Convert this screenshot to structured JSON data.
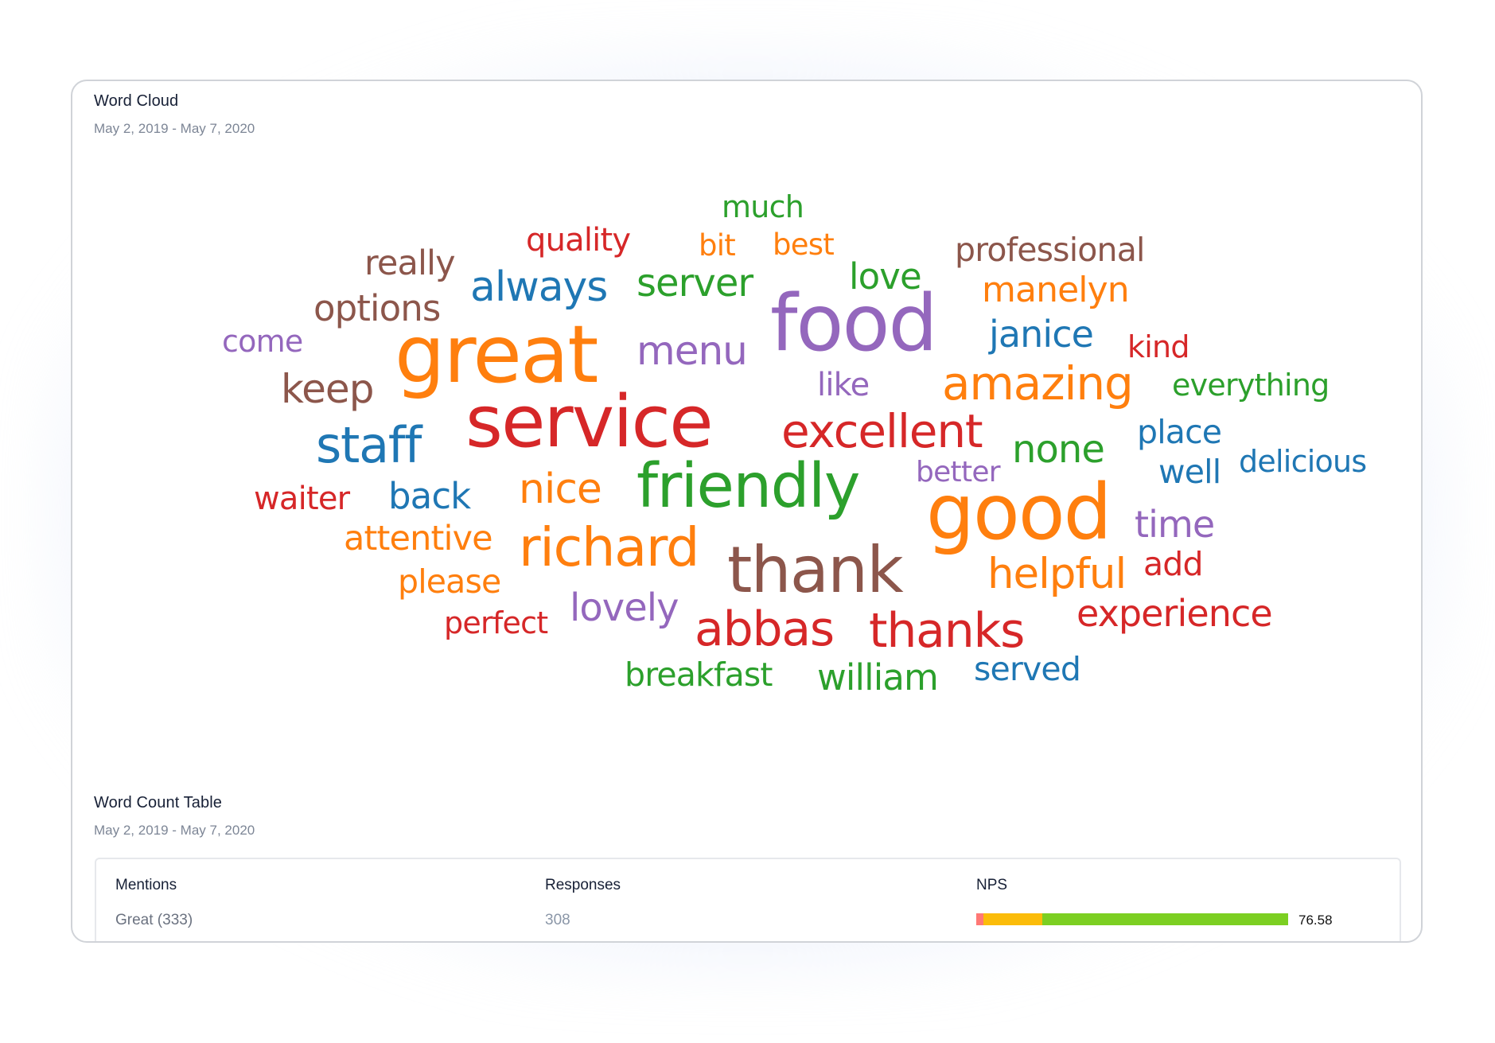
{
  "word_cloud": {
    "title": "Word Cloud",
    "date_range": "May 2, 2019 - May 7, 2020",
    "palette": {
      "blue": "#1f77b4",
      "orange": "#ff7f0e",
      "green": "#2ca02c",
      "red": "#d62728",
      "purple": "#9467bd",
      "brown": "#8c564b"
    },
    "words": [
      {
        "text": "much",
        "weight": 38,
        "color": "green"
      },
      {
        "text": "quality",
        "weight": 40,
        "color": "red"
      },
      {
        "text": "bit",
        "weight": 37,
        "color": "orange"
      },
      {
        "text": "best",
        "weight": 37,
        "color": "orange"
      },
      {
        "text": "really",
        "weight": 43,
        "color": "brown"
      },
      {
        "text": "professional",
        "weight": 41,
        "color": "brown"
      },
      {
        "text": "always",
        "weight": 52,
        "color": "blue"
      },
      {
        "text": "server",
        "weight": 48,
        "color": "green"
      },
      {
        "text": "love",
        "weight": 45,
        "color": "green"
      },
      {
        "text": "manelyn",
        "weight": 44,
        "color": "orange"
      },
      {
        "text": "options",
        "weight": 45,
        "color": "brown"
      },
      {
        "text": "food",
        "weight": 98,
        "color": "purple"
      },
      {
        "text": "janice",
        "weight": 46,
        "color": "blue"
      },
      {
        "text": "kind",
        "weight": 38,
        "color": "red"
      },
      {
        "text": "come",
        "weight": 38,
        "color": "purple"
      },
      {
        "text": "great",
        "weight": 100,
        "color": "orange"
      },
      {
        "text": "menu",
        "weight": 50,
        "color": "purple"
      },
      {
        "text": "keep",
        "weight": 50,
        "color": "brown"
      },
      {
        "text": "like",
        "weight": 40,
        "color": "purple"
      },
      {
        "text": "amazing",
        "weight": 58,
        "color": "orange"
      },
      {
        "text": "everything",
        "weight": 38,
        "color": "green"
      },
      {
        "text": "service",
        "weight": 90,
        "color": "red"
      },
      {
        "text": "excellent",
        "weight": 58,
        "color": "red"
      },
      {
        "text": "staff",
        "weight": 62,
        "color": "blue"
      },
      {
        "text": "none",
        "weight": 48,
        "color": "green"
      },
      {
        "text": "place",
        "weight": 41,
        "color": "blue"
      },
      {
        "text": "delicious",
        "weight": 38,
        "color": "blue"
      },
      {
        "text": "better",
        "weight": 36,
        "color": "purple"
      },
      {
        "text": "well",
        "weight": 41,
        "color": "blue"
      },
      {
        "text": "waiter",
        "weight": 40,
        "color": "red"
      },
      {
        "text": "back",
        "weight": 45,
        "color": "blue"
      },
      {
        "text": "nice",
        "weight": 52,
        "color": "orange"
      },
      {
        "text": "friendly",
        "weight": 77,
        "color": "green"
      },
      {
        "text": "good",
        "weight": 96,
        "color": "orange"
      },
      {
        "text": "time",
        "weight": 46,
        "color": "purple"
      },
      {
        "text": "attentive",
        "weight": 43,
        "color": "orange"
      },
      {
        "text": "richard",
        "weight": 67,
        "color": "orange"
      },
      {
        "text": "thank",
        "weight": 80,
        "color": "brown"
      },
      {
        "text": "helpful",
        "weight": 53,
        "color": "orange"
      },
      {
        "text": "add",
        "weight": 41,
        "color": "red"
      },
      {
        "text": "please",
        "weight": 41,
        "color": "orange"
      },
      {
        "text": "lovely",
        "weight": 48,
        "color": "purple"
      },
      {
        "text": "experience",
        "weight": 46,
        "color": "red"
      },
      {
        "text": "perfect",
        "weight": 38,
        "color": "red"
      },
      {
        "text": "abbas",
        "weight": 60,
        "color": "red"
      },
      {
        "text": "thanks",
        "weight": 60,
        "color": "red"
      },
      {
        "text": "breakfast",
        "weight": 41,
        "color": "green"
      },
      {
        "text": "william",
        "weight": 45,
        "color": "green"
      },
      {
        "text": "served",
        "weight": 41,
        "color": "blue"
      }
    ]
  },
  "word_count_table": {
    "title": "Word Count Table",
    "date_range": "May 2, 2019 - May 7, 2020",
    "columns": {
      "mentions": "Mentions",
      "responses": "Responses",
      "nps": "NPS"
    },
    "rows": [
      {
        "mentions": "Great (333)",
        "responses": "308",
        "nps_value": "76.58",
        "nps_breakdown": {
          "detractors_pct": 2.3,
          "passives_pct": 18.8,
          "promoters_pct": 78.9
        }
      }
    ],
    "nps_colors": {
      "detractors": "#ff7875",
      "passives": "#fbbc0a",
      "promoters": "#7ccf22"
    }
  }
}
